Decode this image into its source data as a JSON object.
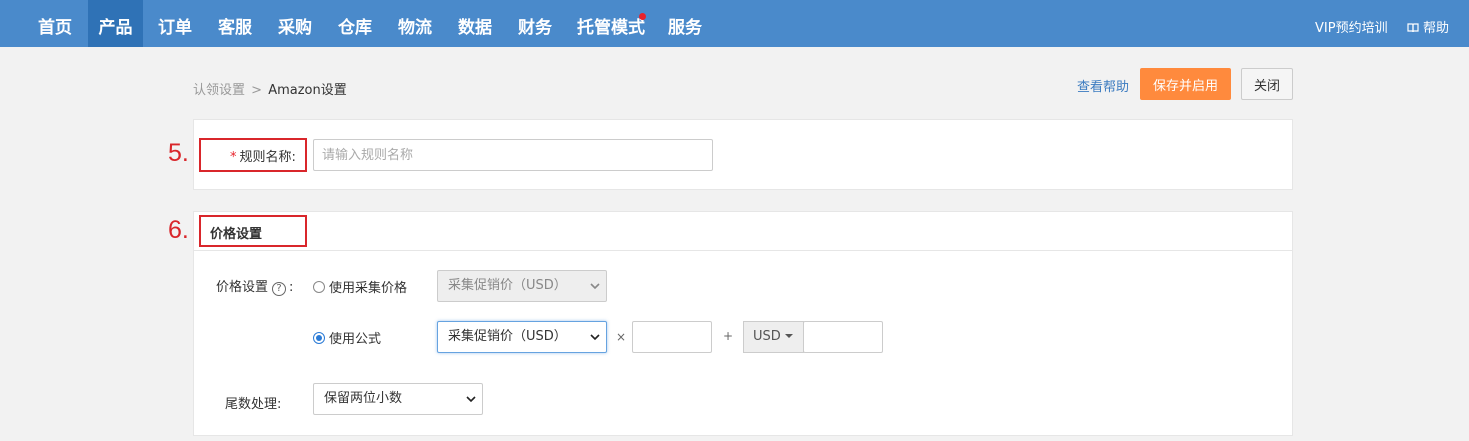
{
  "nav": {
    "items": [
      "首页",
      "产品",
      "订单",
      "客服",
      "采购",
      "仓库",
      "物流",
      "数据",
      "财务",
      "托管模式",
      "服务"
    ],
    "active_index": 1,
    "right": {
      "vip_label": "VIP预约培训",
      "help_label": "帮助",
      "help_icon": "book-icon"
    },
    "badge_item": "托管模式",
    "colors": {
      "bar": "#4a8acb",
      "active": "#2f72b6",
      "badge": "#e8222a"
    }
  },
  "breadcrumb": {
    "parent": "认领设置",
    "separator": ">",
    "current": "Amazon设置"
  },
  "actions": {
    "help_link": "查看帮助",
    "save_label": "保存并启用",
    "close_label": "关闭",
    "save_color": "#ff8a3d"
  },
  "annotations": {
    "step5": "5.",
    "step6": "6."
  },
  "rule": {
    "required_mark": "*",
    "label": "规则名称:",
    "placeholder": "请输入规则名称",
    "value": ""
  },
  "price_section": {
    "title": "价格设置",
    "field_label": "价格设置",
    "help_icon": "question-circle-icon",
    "colon": ":",
    "option_collect": {
      "label": "使用采集价格",
      "checked": false,
      "select_value": "采集促销价（USD）",
      "disabled": true
    },
    "option_formula": {
      "label": "使用公式",
      "checked": true,
      "select_value": "采集促销价（USD）",
      "multiply_sign": "×",
      "multiplier_value": "",
      "plus_sign": "+",
      "currency": "USD",
      "addend_value": ""
    },
    "rounding": {
      "label": "尾数处理:",
      "select_value": "保留两位小数"
    }
  }
}
